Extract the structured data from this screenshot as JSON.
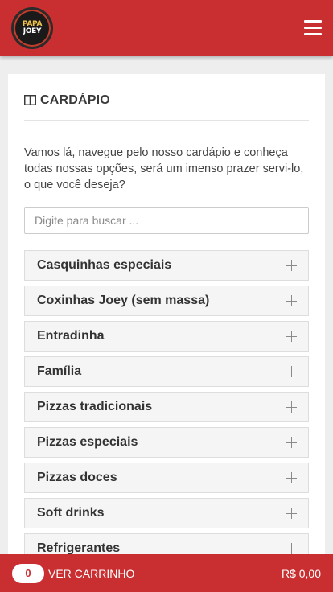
{
  "header": {
    "logo_line1": "PAPA",
    "logo_line2": "JOEY",
    "menu_icon": "hamburger-menu-icon"
  },
  "main": {
    "title_icon": "book-open-icon",
    "title": "CARDÁPIO",
    "intro": "Vamos lá, navegue pelo nosso cardápio e conheça todas nossas opções, será um imenso prazer servi-lo, o que você deseja?",
    "search_placeholder": "Digite para buscar ...",
    "categories": [
      {
        "label": "Casquinhas especiais",
        "icon": "plus-icon"
      },
      {
        "label": "Coxinhas Joey (sem massa)",
        "icon": "plus-icon"
      },
      {
        "label": "Entradinha",
        "icon": "plus-icon"
      },
      {
        "label": "Família",
        "icon": "plus-icon"
      },
      {
        "label": "Pizzas tradicionais",
        "icon": "plus-icon"
      },
      {
        "label": "Pizzas especiais",
        "icon": "plus-icon"
      },
      {
        "label": "Pizzas doces",
        "icon": "plus-icon"
      },
      {
        "label": "Soft drinks",
        "icon": "plus-icon"
      },
      {
        "label": "Refrigerantes",
        "icon": "plus-icon"
      }
    ]
  },
  "cart": {
    "count": "0",
    "label": "VER CARRINHO",
    "total": "R$ 0,00"
  },
  "colors": {
    "brand_red": "#c92f30",
    "background": "#eeeeee"
  }
}
